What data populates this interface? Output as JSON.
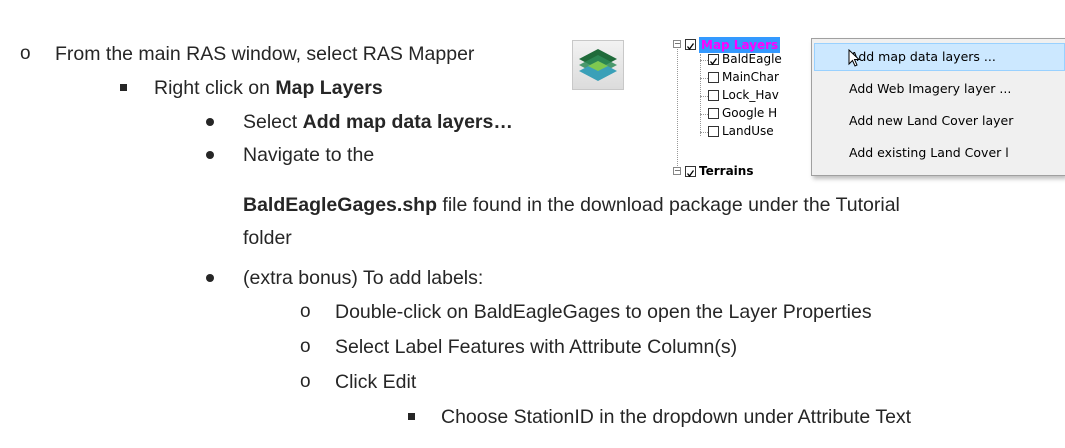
{
  "steps": {
    "step1": "From the main RAS window, select RAS Mapper",
    "step2_pre": "Right click on ",
    "step2_bold": "Map Layers",
    "step3_pre": "Select ",
    "step3_bold": "Add map data layers…",
    "step4_a": "Navigate to the",
    "step4_bold": "BaldEagleGages.shp",
    "step4_b": " file found in the download package under the Tutorial",
    "step4_c": "folder",
    "step5": "(extra bonus) To add labels:",
    "sub1": "Double-click on BaldEagleGages to open the Layer Properties",
    "sub2": "Select Label Features with Attribute Column(s)",
    "sub3": "Click Edit",
    "subsub1": "Choose StationID in the dropdown under Attribute Text"
  },
  "markers": {
    "level1": "o",
    "level4": "o"
  },
  "tree": {
    "root_label": "Map Layers",
    "root_color": "#ff00ff",
    "root_bg": "#3399ff",
    "children": [
      "BaldEagle",
      "MainChar",
      "Lock_Hav",
      "Google H",
      "LandUse"
    ],
    "terrains_label": "Terrains"
  },
  "context_menu": {
    "items": [
      "Add map data layers ...",
      "Add Web Imagery layer ...",
      "Add new Land Cover layer",
      "Add existing Land Cover l"
    ],
    "highlight_color": "#cce8ff"
  },
  "icons": [
    "ras-mapper-icon",
    "cursor-arrow-icon"
  ]
}
